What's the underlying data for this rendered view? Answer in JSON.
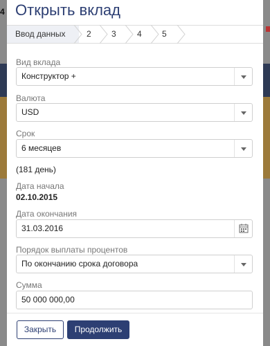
{
  "background": {
    "left_number": "4"
  },
  "modal": {
    "title": "Открыть вклад",
    "steps": [
      "Ввод данных",
      "2",
      "3",
      "4",
      "5"
    ],
    "form": {
      "deposit_type": {
        "label": "Вид вклада",
        "value": "Конструктор +"
      },
      "currency": {
        "label": "Валюта",
        "value": "USD"
      },
      "term": {
        "label": "Срок",
        "value": "6 месяцев",
        "note": "(181 день)"
      },
      "start_date": {
        "label": "Дата начала",
        "value": "02.10.2015"
      },
      "end_date": {
        "label": "Дата окончания",
        "value": "31.03.2016"
      },
      "interest_payment": {
        "label": "Порядок выплаты процентов",
        "value": "По окончанию срока договора"
      },
      "amount": {
        "label": "Сумма",
        "value": "50 000 000,00"
      }
    },
    "buttons": {
      "close": "Закрыть",
      "continue": "Продолжить"
    }
  },
  "colors": {
    "accent": "#2d3f73",
    "active_step_bg": "#eef0f5"
  }
}
